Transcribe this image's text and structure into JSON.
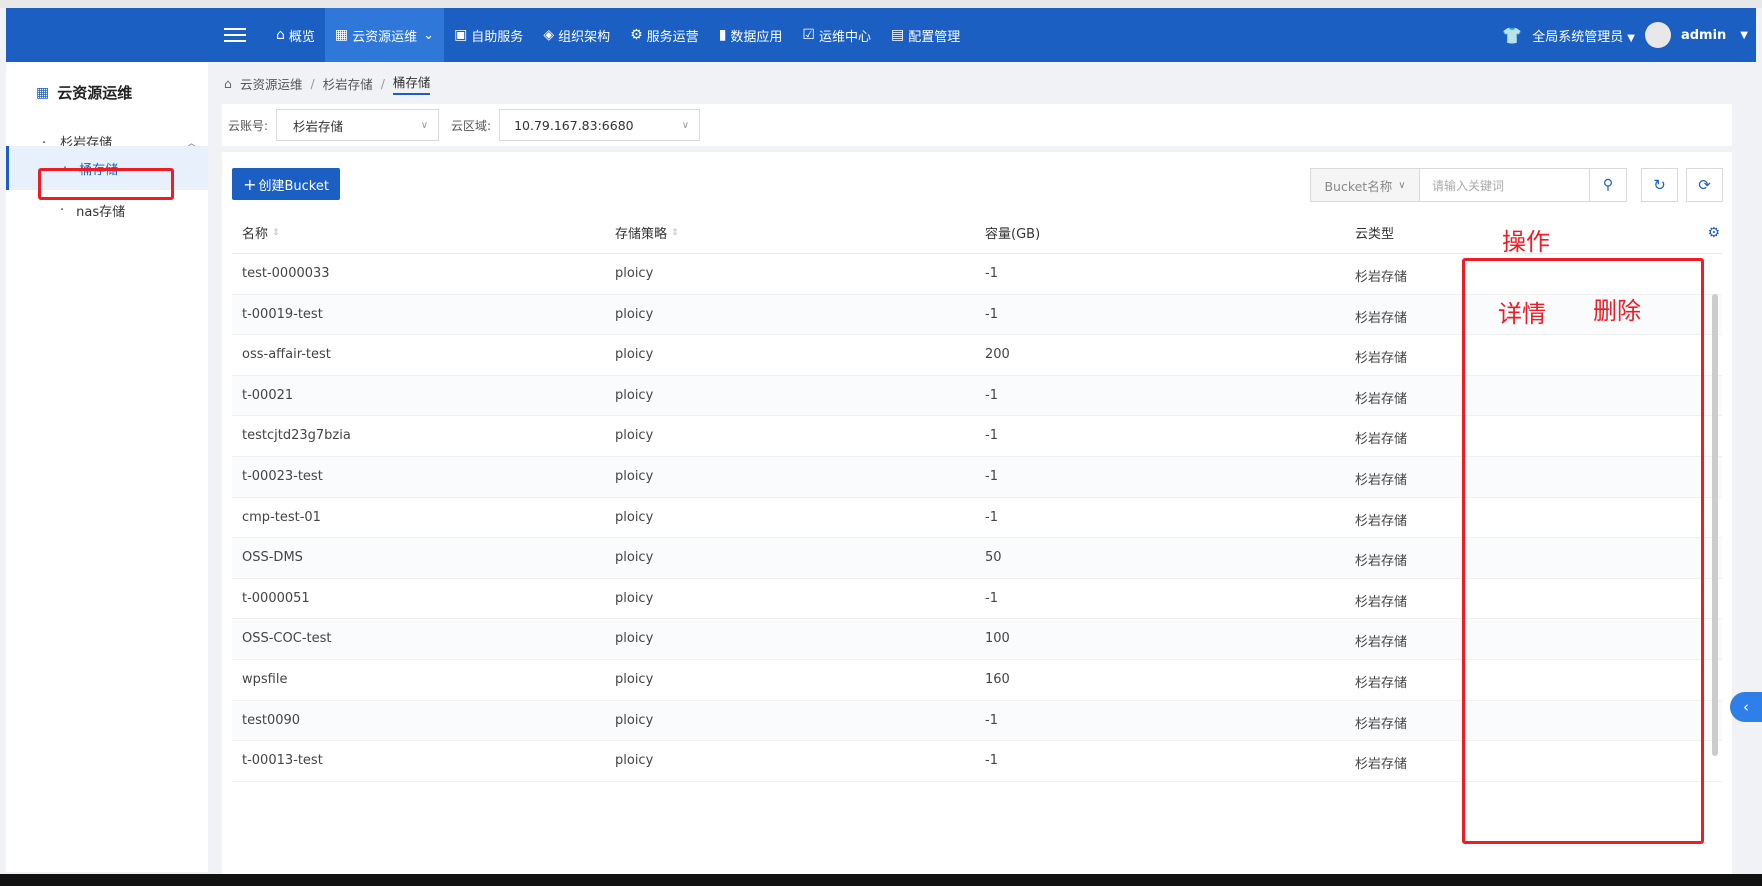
{
  "nav": {
    "items": [
      {
        "icon": "home-icon",
        "glyph": "⌂",
        "label": "概览"
      },
      {
        "icon": "cloud-resource-icon",
        "glyph": "▦",
        "label": "云资源运维",
        "active": true,
        "caret": "⌄"
      },
      {
        "icon": "self-service-icon",
        "glyph": "▣",
        "label": "自助服务"
      },
      {
        "icon": "org-icon",
        "glyph": "◈",
        "label": "组织架构"
      },
      {
        "icon": "service-ops-icon",
        "glyph": "⚙",
        "label": "服务运营"
      },
      {
        "icon": "data-app-icon",
        "glyph": "▮",
        "label": "数据应用"
      },
      {
        "icon": "ops-center-icon",
        "glyph": "☑",
        "label": "运维中心"
      },
      {
        "icon": "config-icon",
        "glyph": "▤",
        "label": "配置管理"
      }
    ],
    "role": "全局系统管理员",
    "user": "admin"
  },
  "sidebar": {
    "title": "云资源运维",
    "group": "杉岩存储",
    "items": [
      {
        "label": "桶存储",
        "active": true
      },
      {
        "label": "nas存储"
      }
    ]
  },
  "breadcrumb": {
    "items": [
      "云资源运维",
      "杉岩存储",
      "桶存储"
    ]
  },
  "filters": {
    "account_label": "云账号:",
    "account_value": "杉岩存储",
    "region_label": "云区域:",
    "region_value": "10.79.167.83:6680"
  },
  "toolbar": {
    "create_label": "创建Bucket",
    "search_field": "Bucket名称",
    "search_placeholder": "请输入关键词"
  },
  "table": {
    "columns": [
      "名称",
      "存储策略",
      "容量(GB)",
      "云类型"
    ],
    "rows": [
      [
        "test-0000033",
        "ploicy",
        "-1",
        "杉岩存储"
      ],
      [
        "t-00019-test",
        "ploicy",
        "-1",
        "杉岩存储"
      ],
      [
        "oss-affair-test",
        "ploicy",
        "200",
        "杉岩存储"
      ],
      [
        "t-00021",
        "ploicy",
        "-1",
        "杉岩存储"
      ],
      [
        "testcjtd23g7bzia",
        "ploicy",
        "-1",
        "杉岩存储"
      ],
      [
        "t-00023-test",
        "ploicy",
        "-1",
        "杉岩存储"
      ],
      [
        "cmp-test-01",
        "ploicy",
        "-1",
        "杉岩存储"
      ],
      [
        "OSS-DMS",
        "ploicy",
        "50",
        "杉岩存储"
      ],
      [
        "t-0000051",
        "ploicy",
        "-1",
        "杉岩存储"
      ],
      [
        "OSS-COC-test",
        "ploicy",
        "100",
        "杉岩存储"
      ],
      [
        "wpsfile",
        "ploicy",
        "160",
        "杉岩存储"
      ],
      [
        "test0090",
        "ploicy",
        "-1",
        "杉岩存储"
      ],
      [
        "t-00013-test",
        "ploicy",
        "-1",
        "杉岩存储"
      ]
    ]
  },
  "annotations": {
    "op": "操作",
    "detail": "详情",
    "delete": "删除",
    "color": "#ee1c24"
  },
  "colors": {
    "primary": "#1a5fc1",
    "nav_active": "#2f77d8"
  }
}
